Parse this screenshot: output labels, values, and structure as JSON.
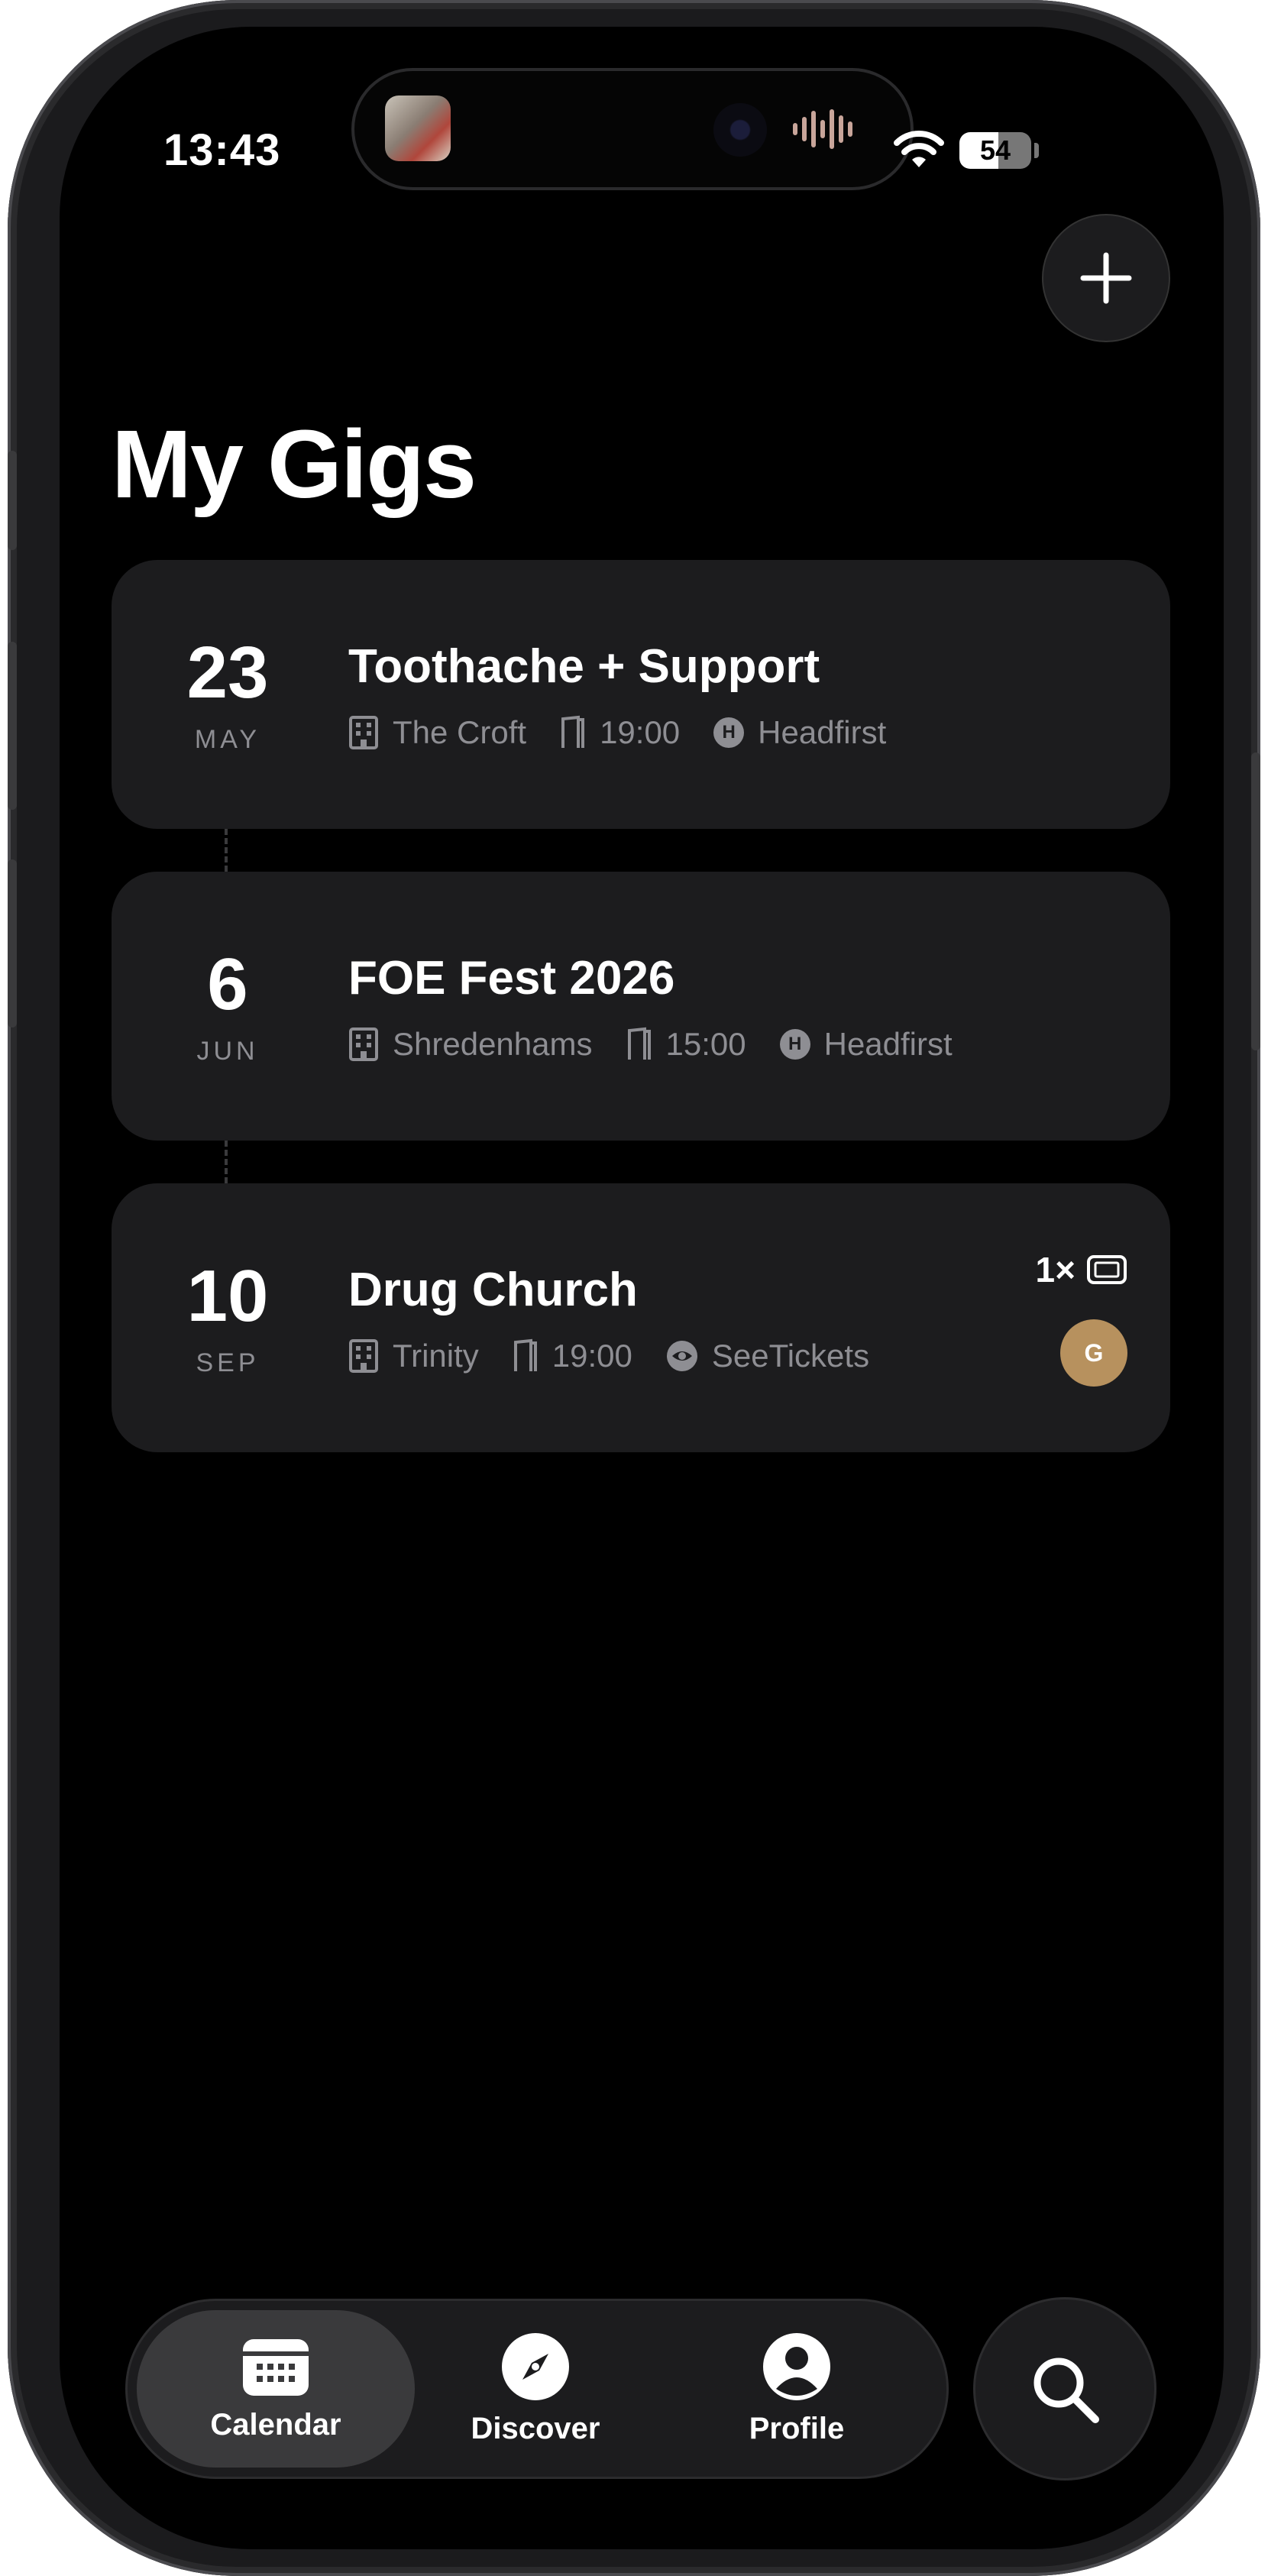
{
  "status_bar": {
    "time": "13:43",
    "battery": "54"
  },
  "page": {
    "title": "My Gigs"
  },
  "gigs": [
    {
      "day": "23",
      "month": "MAY",
      "title": "Toothache + Support",
      "venue": "The Croft",
      "time": "19:00",
      "provider_badge": "H",
      "provider": "Headfirst"
    },
    {
      "day": "6",
      "month": "JUN",
      "title": "FOE Fest 2026",
      "venue": "Shredenhams",
      "time": "15:00",
      "provider_badge": "H",
      "provider": "Headfirst"
    },
    {
      "day": "10",
      "month": "SEP",
      "title": "Drug Church",
      "venue": "Trinity",
      "time": "19:00",
      "provider": "SeeTickets",
      "ticket_count": "1×",
      "attendee_initial": "G"
    }
  ],
  "tabbar": {
    "tabs": [
      {
        "label": "Calendar",
        "icon": "calendar-icon",
        "active": true
      },
      {
        "label": "Discover",
        "icon": "compass-icon",
        "active": false
      },
      {
        "label": "Profile",
        "icon": "person-icon",
        "active": false
      }
    ]
  },
  "colors": {
    "background": "#000000",
    "card": "#1c1c1e",
    "muted_text": "#8e8e93",
    "avatar": "#b7915e"
  }
}
